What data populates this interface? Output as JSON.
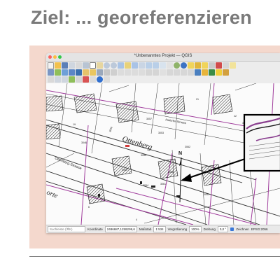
{
  "slide": {
    "title": "Ziel: ... georeferenzieren"
  },
  "window": {
    "title": "*Unbenanntes Projekt — QGIS"
  },
  "map": {
    "street_labels": [
      "Ottenberg",
      "Ottenberg-Strasse",
      "Aadorfer-Strasse"
    ],
    "north_label": "N",
    "parcel_numbers": [
      "3060",
      "3055",
      "3054",
      "3060",
      "3056",
      "3061",
      "3053",
      "3062",
      "30",
      "3051",
      "3050",
      "3046",
      "3057"
    ],
    "house_numbers": [
      "6",
      "4",
      "19",
      "21",
      "22"
    ],
    "street_fragment": "orte"
  },
  "status": {
    "locator_placeholder": "Suchleiste (⌘K)",
    "coordinate_label": "Koordinate",
    "coordinate_value": "2486687,1259299,6",
    "scale_label": "Maßstab",
    "scale_value": "1:534",
    "magnifier_label": "Vergrößerung",
    "magnifier_value": "100%",
    "rotation_label": "Drehung",
    "rotation_value": "0,0 °",
    "render_label": "Zeichnen",
    "crs_label": "EPSG:2056"
  }
}
